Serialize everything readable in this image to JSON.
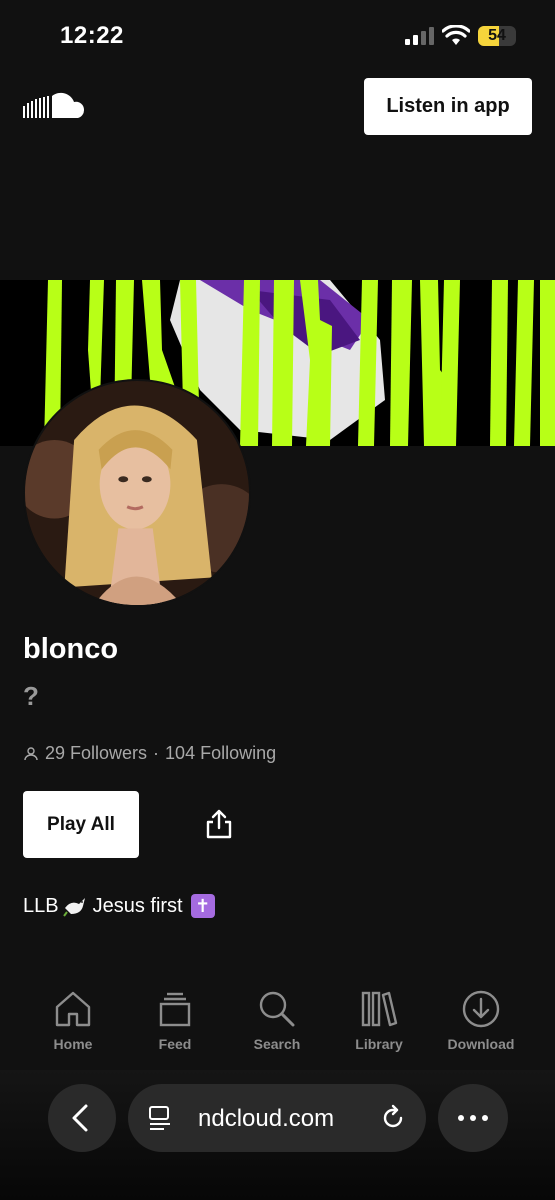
{
  "status": {
    "time": "12:22",
    "battery": "54",
    "battery_level": 0.54
  },
  "header": {
    "logo": "soundcloud-logo-icon",
    "listen_button": "Listen in app"
  },
  "colors": {
    "background": "#111111",
    "banner_accent": "#b8ff17",
    "inactive_tab": "#8d8d8d"
  },
  "profile": {
    "username": "blonco",
    "subtitle": "?",
    "followers": "29 Followers",
    "separator": "·",
    "following": "104 Following",
    "play_all": "Play All",
    "bio": "LLB",
    "bio_rest": "Jesus first"
  },
  "tabs": [
    {
      "label": "Home",
      "icon": "home-icon"
    },
    {
      "label": "Feed",
      "icon": "feed-icon"
    },
    {
      "label": "Search",
      "icon": "search-icon"
    },
    {
      "label": "Library",
      "icon": "library-icon"
    },
    {
      "label": "Download",
      "icon": "download-icon"
    }
  ],
  "browser": {
    "url": "ndcloud.com"
  }
}
